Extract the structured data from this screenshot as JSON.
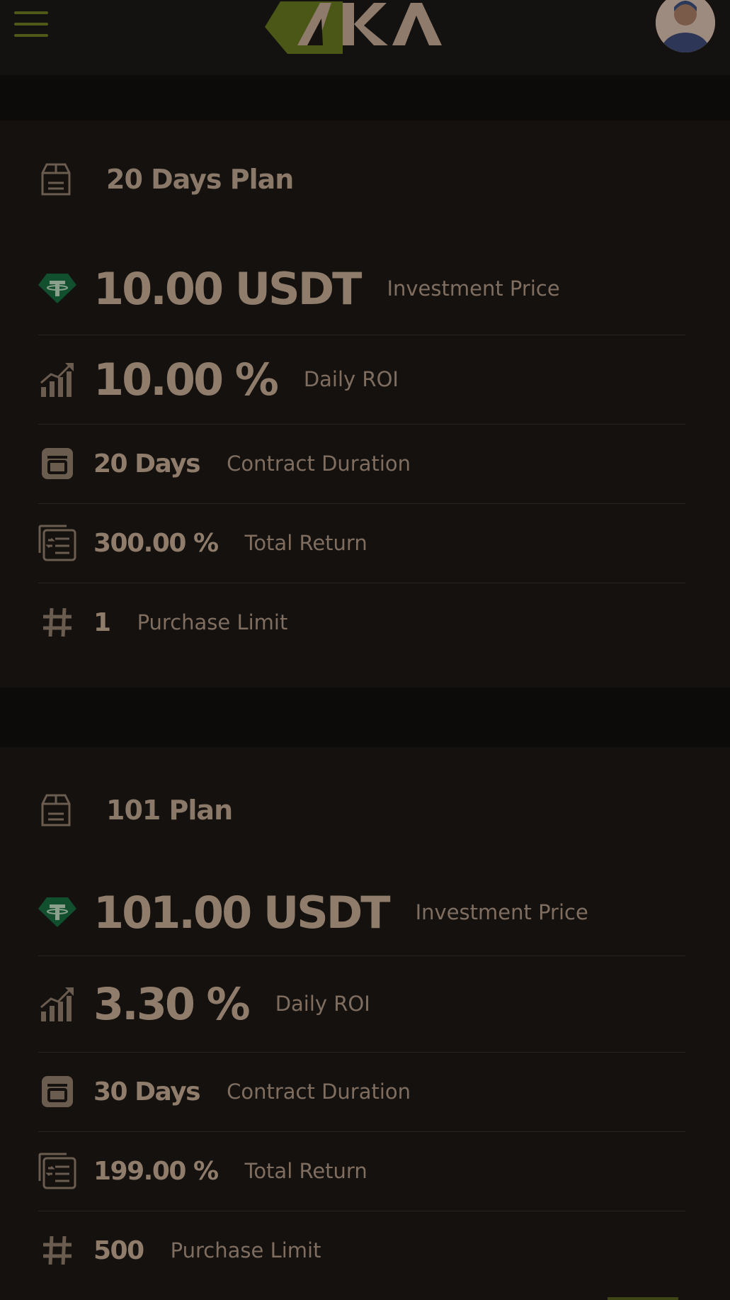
{
  "header": {
    "logo_text": "AKA",
    "menu_icon": "hamburger-menu-icon",
    "avatar_icon": "user-avatar"
  },
  "plans": [
    {
      "title": "20 Days Plan",
      "investment": {
        "value": "10.00 USDT",
        "label": "Investment Price"
      },
      "roi": {
        "value": "10.00 %",
        "label": "Daily ROI"
      },
      "duration": {
        "value": "20 Days",
        "label": "Contract Duration"
      },
      "total": {
        "value": "300.00 %",
        "label": "Total Return"
      },
      "limit": {
        "value": "1",
        "label": "Purchase Limit"
      }
    },
    {
      "title": "101 Plan",
      "investment": {
        "value": "101.00 USDT",
        "label": "Investment Price"
      },
      "roi": {
        "value": "3.30 %",
        "label": "Daily ROI"
      },
      "duration": {
        "value": "30 Days",
        "label": "Contract Duration"
      },
      "total": {
        "value": "199.00 %",
        "label": "Total Return"
      },
      "limit": {
        "value": "500",
        "label": "Purchase Limit"
      }
    }
  ],
  "colors": {
    "background": "#0e0d0c",
    "card": "#14110f",
    "text": "#8c7a6a",
    "accent_green": "#4f5a1a",
    "tether_green": "#124f2f"
  }
}
